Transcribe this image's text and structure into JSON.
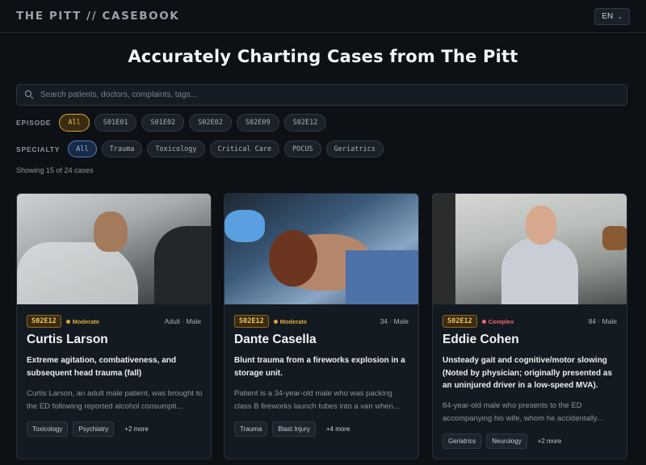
{
  "app": {
    "brand": "THE PITT // CASEBOOK",
    "language": "EN"
  },
  "hero": {
    "title": "Accurately Charting Cases from The Pitt"
  },
  "search": {
    "placeholder": "Search patients, doctors, complaints, tags..."
  },
  "filters": {
    "episode_label": "EPISODE",
    "episodes": [
      "All",
      "S01E01",
      "S01E02",
      "S02E02",
      "S02E09",
      "S02E12"
    ],
    "episode_selected": "All",
    "specialty_label": "SPECIALTY",
    "specialties": [
      "All",
      "Trauma",
      "Toxicology",
      "Critical Care",
      "POCUS",
      "Geriatrics"
    ],
    "specialty_selected": "All"
  },
  "results": {
    "count_text": "Showing 15 of 24 cases"
  },
  "colors": {
    "accent_gold": "#f0c060",
    "accent_blue": "#9cc2f0",
    "moderate": "#e3a53c",
    "complex": "#e86a6a"
  },
  "cases": [
    {
      "episode": "S02E12",
      "severity": "Moderate",
      "demographics": "Adult · Male",
      "name": "Curtis Larson",
      "complaint": "Extreme agitation, combativeness, and subsequent head trauma (fall)",
      "summary": "Curtis Larson, an adult male patient, was brought to the ED following reported alcohol consumpti...",
      "tags": [
        "Toxicology",
        "Psychiatry"
      ],
      "more": "+2 more"
    },
    {
      "episode": "S02E12",
      "severity": "Moderate",
      "demographics": "34 · Male",
      "name": "Dante Casella",
      "complaint": "Blunt trauma from a fireworks explosion in a storage unit.",
      "summary": "Patient is a 34-year-old male who was packing class B fireworks launch tubes into a van when...",
      "tags": [
        "Trauma",
        "Blast Injury"
      ],
      "more": "+4 more"
    },
    {
      "episode": "S02E12",
      "severity": "Complex",
      "demographics": "84 · Male",
      "name": "Eddie Cohen",
      "complaint": "Unsteady gait and cognitive/motor slowing (Noted by physician; originally presented as an uninjured driver in a low-speed MVA).",
      "summary": "84-year-old male who presents to the ED accompanying his wife, whom he accidentally...",
      "tags": [
        "Geriatrics",
        "Neurology"
      ],
      "more": "+2 more"
    }
  ]
}
